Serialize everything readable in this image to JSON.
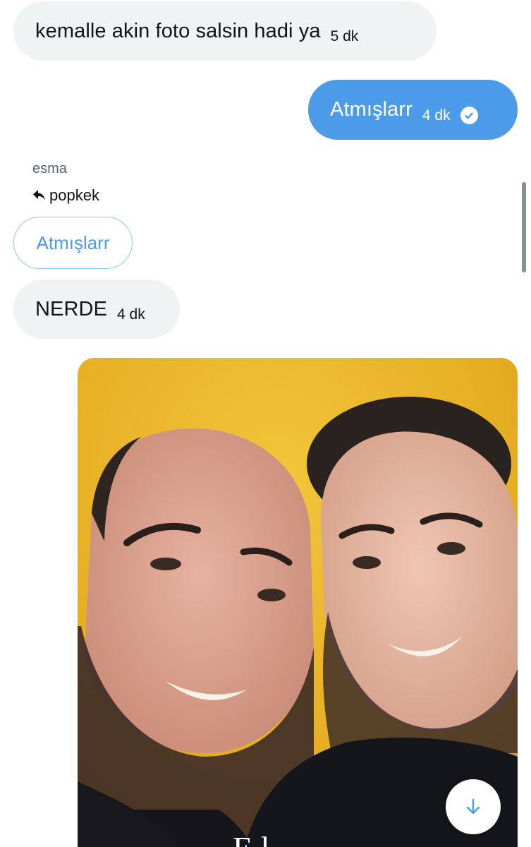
{
  "messages": [
    {
      "direction": "incoming",
      "text": "kemalle akin foto salsin hadi ya",
      "time": "5 dk"
    },
    {
      "direction": "outgoing",
      "text": "Atmışlarr",
      "time": "4 dk",
      "status": "seen"
    },
    {
      "direction": "incoming",
      "text": "NERDE",
      "time": "4 dk"
    }
  ],
  "reply": {
    "sender": "esma",
    "reply_to": "popkek",
    "quoted_text": "Atmışlarr"
  },
  "photo": {
    "caption_fragment": "E     l"
  },
  "icons": {
    "reply": "reply-arrow-icon",
    "seen": "check-circle-icon",
    "scroll_down": "arrow-down-icon"
  },
  "colors": {
    "incoming_bubble": "#eff3f4",
    "outgoing_bubble": "#4c9be8",
    "accent": "#4c9be8",
    "secondary_text": "#536471"
  }
}
